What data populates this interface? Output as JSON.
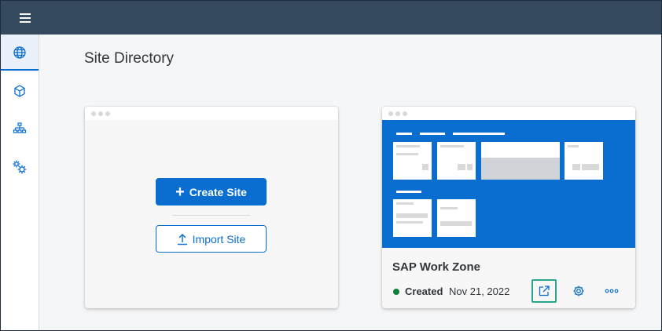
{
  "shell": {
    "menu_icon": "hamburger-icon",
    "sidebar": [
      {
        "icon": "globe-icon",
        "active": true
      },
      {
        "icon": "cube-icon",
        "active": false
      },
      {
        "icon": "hierarchy-icon",
        "active": false
      },
      {
        "icon": "settings-icon",
        "active": false
      }
    ]
  },
  "page": {
    "title": "Site Directory"
  },
  "create_card": {
    "create_label": "Create Site",
    "import_label": "Import Site"
  },
  "site_card": {
    "name": "SAP Work Zone",
    "status": "Created",
    "status_color": "#107e3e",
    "date": "Nov 21, 2022",
    "actions": [
      "open-external-icon",
      "settings-icon",
      "overflow-icon"
    ]
  },
  "colors": {
    "shell_bar": "#354a5f",
    "accent": "#0a6ed1",
    "highlight_border": "#2ca58d"
  }
}
